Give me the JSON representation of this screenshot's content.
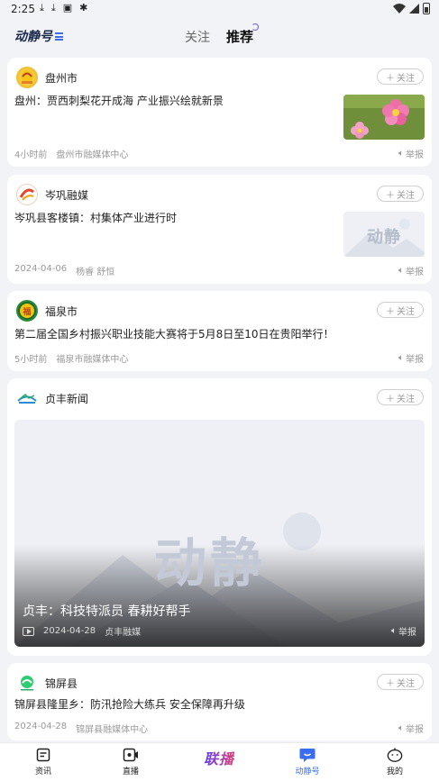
{
  "status_bar": {
    "time": "2:25"
  },
  "header": {
    "logo_text": "动静号",
    "tabs": [
      {
        "label": "关注",
        "active": false
      },
      {
        "label": "推荐",
        "active": true
      }
    ]
  },
  "follow_label": "关注",
  "report_label": "举报",
  "feed": [
    {
      "source": "盘州市",
      "title": "盘州：贾西刺梨花开成海 产业振兴绘就新景",
      "time": "4小时前",
      "author": "盘州市融媒体中心",
      "thumb": "flower"
    },
    {
      "source": "岑巩融媒",
      "title": "岑巩县客楼镇：村集体产业进行时",
      "time": "2024-04-06",
      "author": "杨睿 舒恒",
      "thumb": "placeholder"
    },
    {
      "source": "福泉市",
      "title": "第二届全国乡村振兴职业技能大赛将于5月8日至10日在贵阳举行！",
      "time": "5小时前",
      "author": "福泉市融媒体中心",
      "thumb": "none"
    },
    {
      "source": "贞丰新闻",
      "title": "贞丰：科技特派员  春耕好帮手",
      "time": "2024-04-28",
      "author": "贞丰融媒",
      "thumb": "video"
    },
    {
      "source": "锦屏县",
      "title": "锦屏县隆里乡：防汛抢险大练兵 安全保障再升级",
      "time": "2024-04-28",
      "author": "锦屏县融媒体中心",
      "thumb": "none"
    }
  ],
  "placeholder_logo": "动静",
  "bottom_nav": [
    {
      "label": "资讯",
      "icon": "news-icon",
      "active": false
    },
    {
      "label": "直播",
      "icon": "live-icon",
      "active": false
    },
    {
      "label": "联播",
      "icon": "lianbo-logo",
      "active": false
    },
    {
      "label": "动静号",
      "icon": "dongjinghao-icon",
      "active": true
    },
    {
      "label": "我的",
      "icon": "profile-icon",
      "active": false
    }
  ],
  "colors": {
    "accent": "#3a6df0",
    "background": "#f2f3f6"
  }
}
